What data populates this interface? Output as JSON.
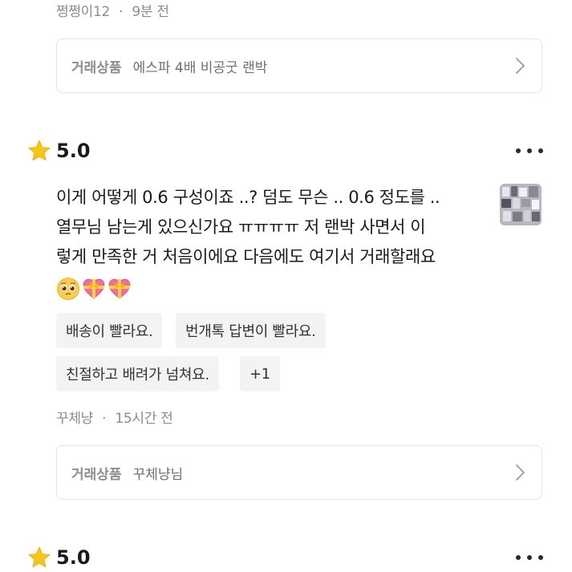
{
  "top_review": {
    "author": "쩡쩡이12",
    "separator": "·",
    "time": "9분 전",
    "product_label": "거래상품",
    "product_name": "에스파 4배 비공굿 랜박"
  },
  "review": {
    "star_icon": "star-icon",
    "rating": "5.0",
    "more_icon": "more-horizontal-icon",
    "text_lines": [
      "이게 어떻게 0.6 구성이죠 ..? 덤도 무슨 .. 0.6 정도를 ..",
      "열무님 남는게 있으신가요 ㅠㅠㅠㅠ 저 랜박 사면서 이",
      "렇게 만족한 거 처음이에요 다음에도 여기서 거래할래요"
    ],
    "emojis": [
      "pleading-face-emoji",
      "heart-with-ribbon-emoji",
      "heart-with-ribbon-emoji"
    ],
    "thumbnail_icon": "photo-thumbnail",
    "tags": [
      "배송이 빨라요.",
      "번개톡 답변이 빨라요.",
      "친절하고 배려가 넘쳐요.",
      "+1"
    ],
    "author": "꾸체냥",
    "separator": "·",
    "time": "15시간 전",
    "product_label": "거래상품",
    "product_name": "꾸체냥님"
  },
  "next_review": {
    "rating": "5.0"
  },
  "colors": {
    "star": "#f5c518",
    "meta_text": "#8c8c8c",
    "tag_bg": "#f3f3f3",
    "card_border": "#e4e4e4"
  }
}
